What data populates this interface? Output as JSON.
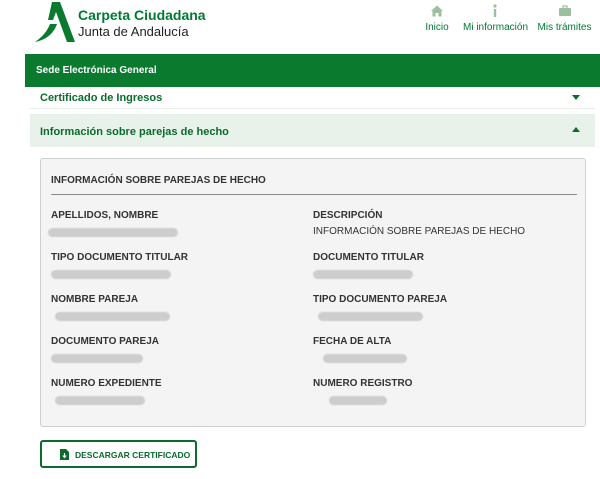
{
  "header": {
    "title": "Carpeta Ciudadana",
    "subtitle": "Junta de Andalucía",
    "nav": [
      {
        "label": "Inicio",
        "icon": "home-icon"
      },
      {
        "label": "Mi información",
        "icon": "info-icon"
      },
      {
        "label": "Mis trámites",
        "icon": "briefcase-icon"
      }
    ]
  },
  "bar": {
    "title": "Sede Electrónica General"
  },
  "accordion": [
    {
      "label": "Certificado de Ingresos",
      "expanded": false
    },
    {
      "label": "Información sobre parejas de hecho",
      "expanded": true
    }
  ],
  "panel": {
    "title": "INFORMACIÓN SOBRE PAREJAS DE HECHO",
    "fields": [
      {
        "label": "APELLIDOS, NOMBRE",
        "value": null,
        "redacted": true
      },
      {
        "label": "DESCRIPCIÓN",
        "value": "INFORMACIÓN SOBRE PAREJAS DE HECHO",
        "redacted": false
      },
      {
        "label": "TIPO DOCUMENTO TITULAR",
        "value": null,
        "redacted": true
      },
      {
        "label": "DOCUMENTO TITULAR",
        "value": null,
        "redacted": true
      },
      {
        "label": "NOMBRE PAREJA",
        "value": null,
        "redacted": true
      },
      {
        "label": "TIPO DOCUMENTO PAREJA",
        "value": null,
        "redacted": true
      },
      {
        "label": "DOCUMENTO PAREJA",
        "value": null,
        "redacted": true
      },
      {
        "label": "FECHA DE ALTA",
        "value": null,
        "redacted": true
      },
      {
        "label": "NUMERO EXPEDIENTE",
        "value": null,
        "redacted": true
      },
      {
        "label": "NUMERO REGISTRO",
        "value": null,
        "redacted": true
      }
    ]
  },
  "download": {
    "label": "DESCARGAR CERTIFICADO",
    "icon": "file-download-icon"
  },
  "colors": {
    "brand_green": "#0a7a2f",
    "text_green": "#0a6b2d",
    "panel_bg": "#f4f4f4"
  }
}
